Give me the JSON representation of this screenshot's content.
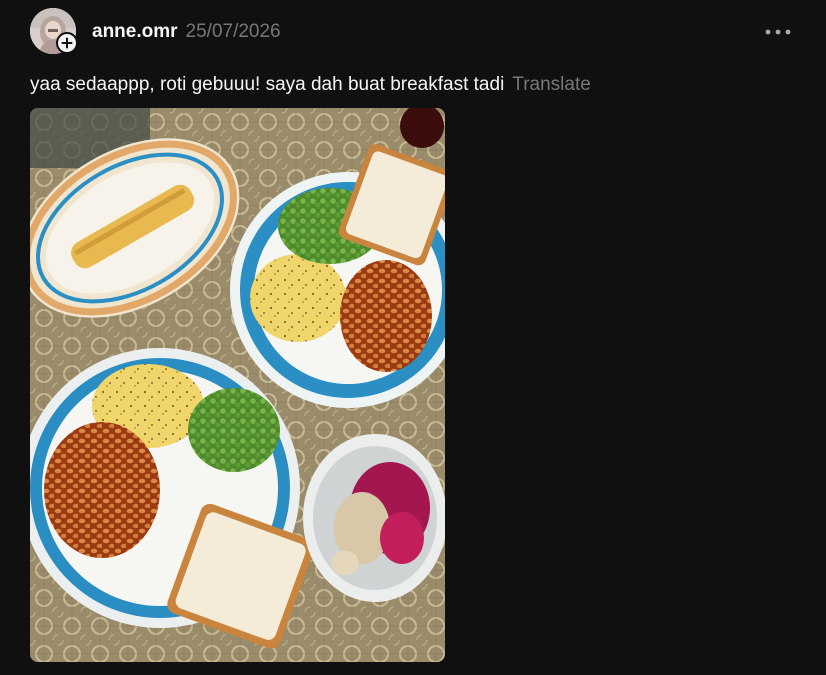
{
  "post": {
    "username": "anne.omr",
    "timestamp": "25/07/2026",
    "caption": "yaa sedaappp, roti gebuuu! saya dah buat breakfast tadi",
    "translate_label": "Translate"
  },
  "icons": {
    "follow": "plus-icon",
    "more": "more-horizontal-icon"
  },
  "colors": {
    "background": "#101010",
    "primary_text": "#f3f5f7",
    "secondary_text": "#777777"
  }
}
